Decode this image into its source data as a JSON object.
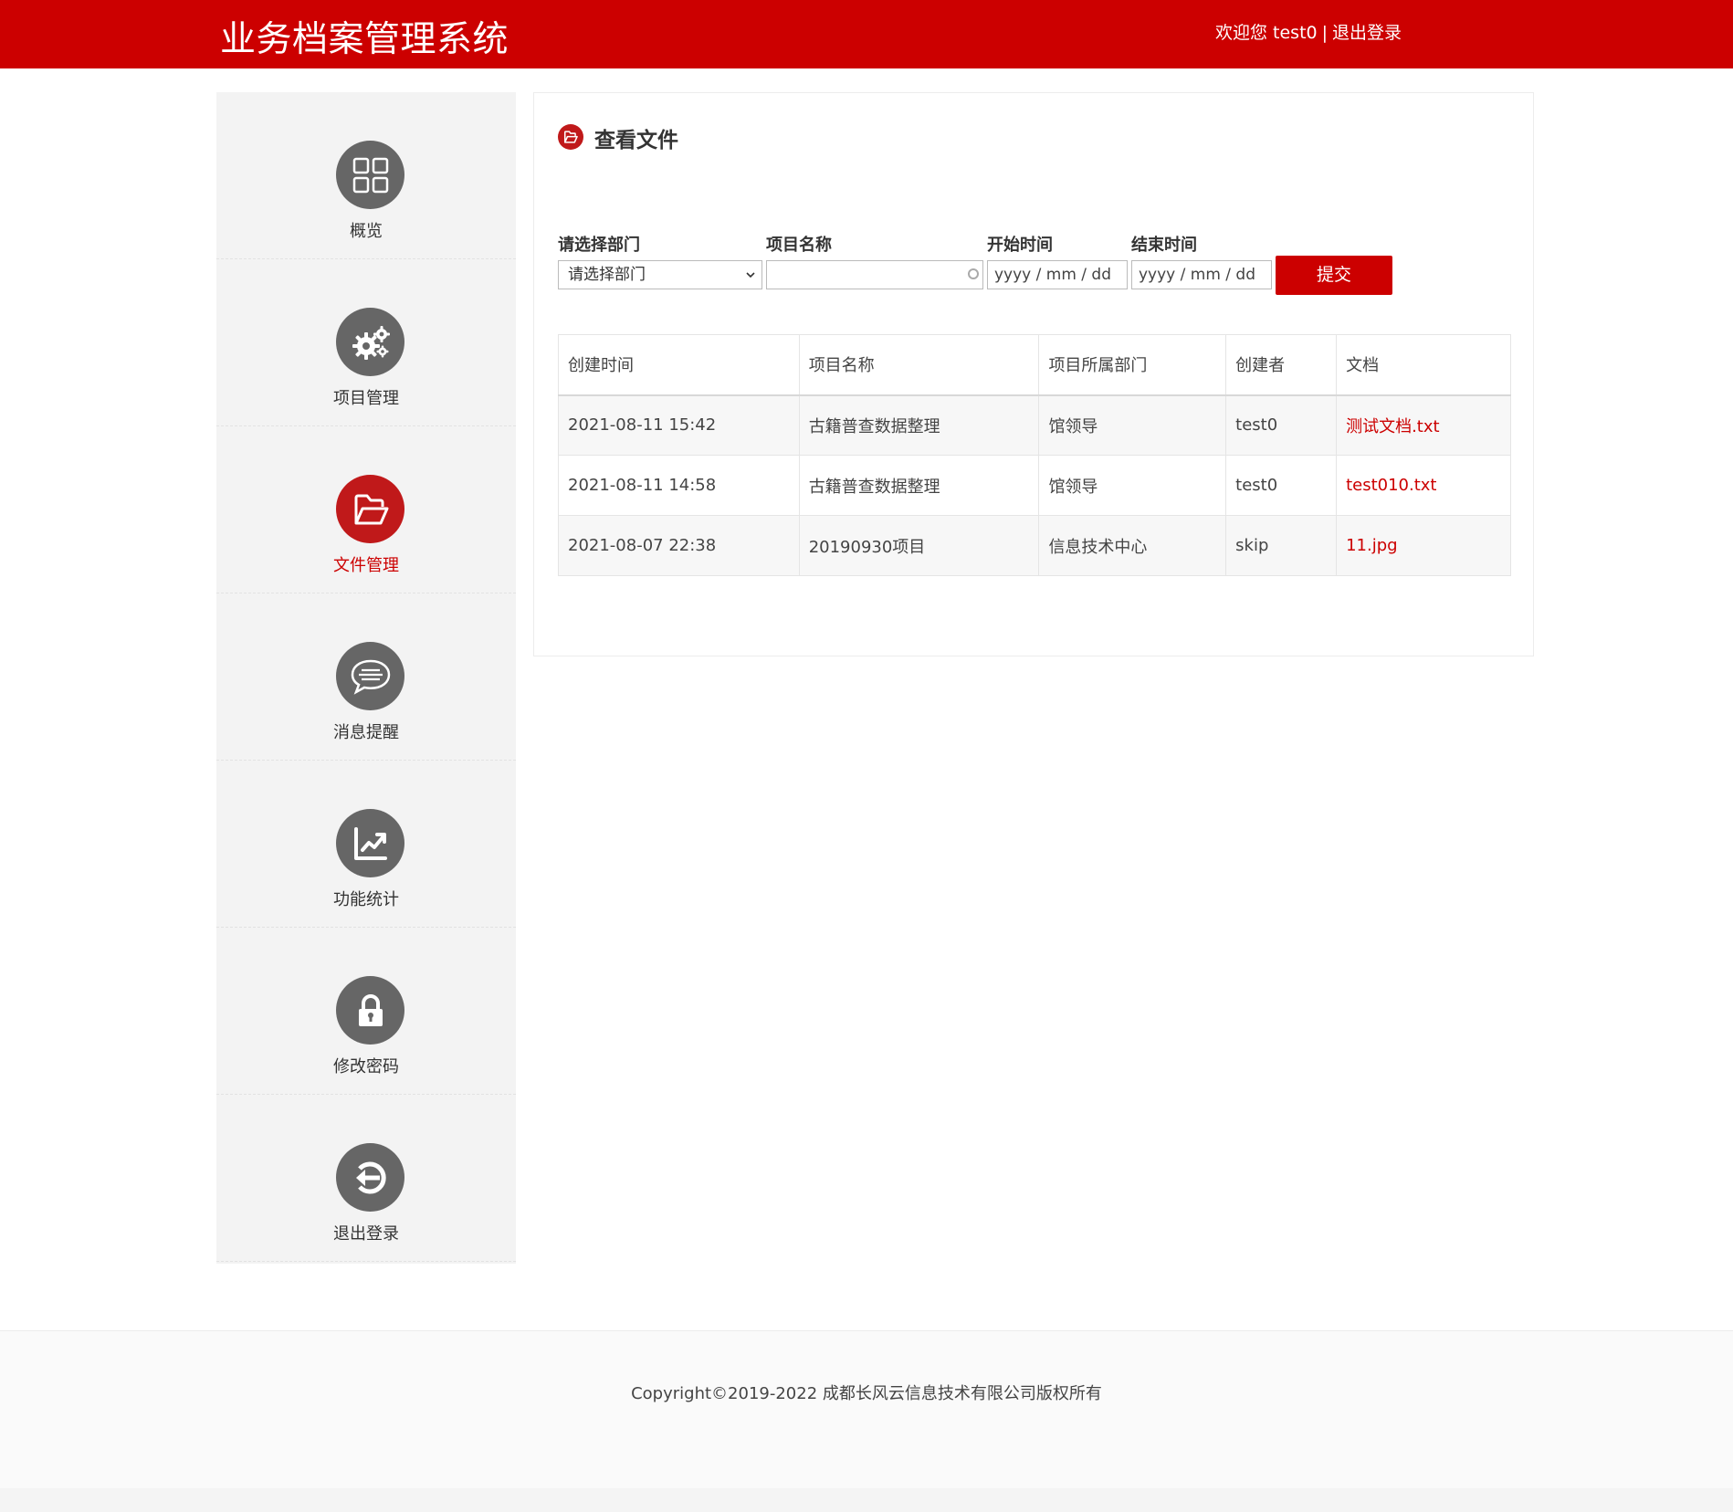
{
  "header": {
    "title": "业务档案管理系统",
    "welcome": "欢迎您 test0",
    "separator": "|",
    "logout": "退出登录"
  },
  "sidebar": {
    "items": [
      {
        "label": "概览",
        "icon": "grid-icon"
      },
      {
        "label": "项目管理",
        "icon": "gears-icon"
      },
      {
        "label": "文件管理",
        "icon": "folder-open-icon",
        "active": true
      },
      {
        "label": "消息提醒",
        "icon": "chat-bubble-icon"
      },
      {
        "label": "功能统计",
        "icon": "trend-chart-icon"
      },
      {
        "label": "修改密码",
        "icon": "lock-icon"
      },
      {
        "label": "退出登录",
        "icon": "exit-icon"
      }
    ]
  },
  "main": {
    "title": "查看文件",
    "filters": {
      "dept_label": "请选择部门",
      "dept_selected": "请选择部门",
      "project_label": "项目名称",
      "project_value": "",
      "start_label": "开始时间",
      "start_placeholder": "yyyy / mm / dd",
      "end_label": "结束时间",
      "end_placeholder": "yyyy / mm / dd",
      "submit": "提交"
    },
    "table": {
      "headers": [
        "创建时间",
        "项目名称",
        "项目所属部门",
        "创建者",
        "文档"
      ],
      "rows": [
        [
          "2021-08-11 15:42",
          "古籍普查数据整理",
          "馆领导",
          "test0",
          "测试文档.txt"
        ],
        [
          "2021-08-11 14:58",
          "古籍普查数据整理",
          "馆领导",
          "test0",
          "test010.txt"
        ],
        [
          "2021-08-07 22:38",
          "20190930项目",
          "信息技术中心",
          "skip",
          "11.jpg"
        ]
      ]
    }
  },
  "footer": {
    "copyright": "Copyright©2019-2022  成都长风云信息技术有限公司版权所有"
  },
  "colors": {
    "brand_red": "#cc0000",
    "icon_gray": "#666666",
    "sidebar_bg": "#f3f3f3"
  }
}
